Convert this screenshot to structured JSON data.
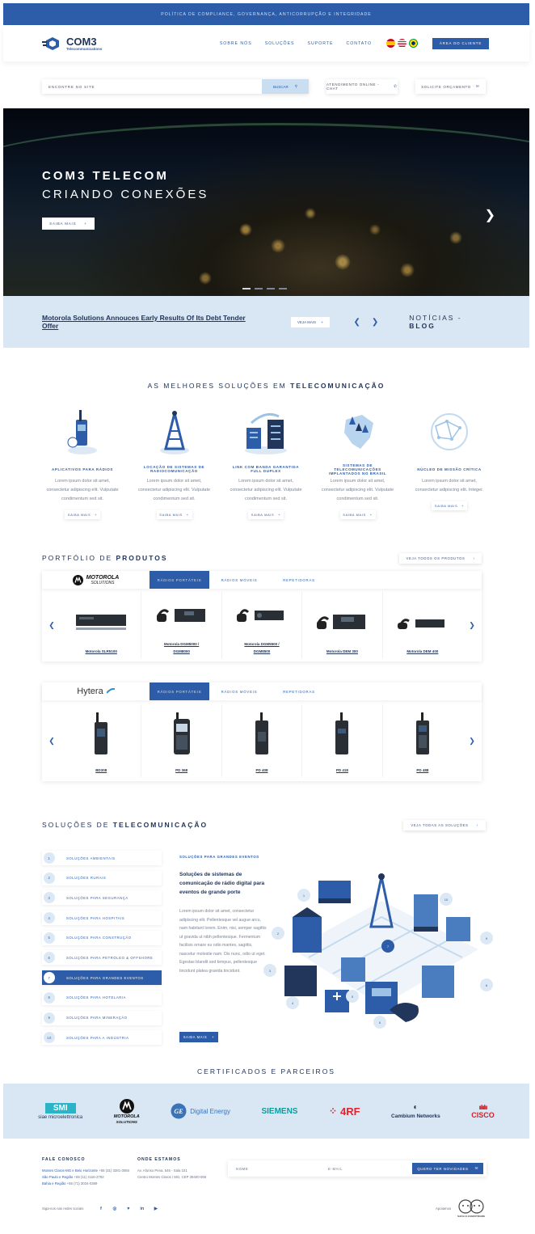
{
  "topbar": {
    "text": "POLÍTICA DE COMPLIANCE, GOVERNANÇA, ANTICORRUPÇÃO E INTEGRIDADE"
  },
  "header": {
    "logo_name": "COM3",
    "logo_sub": "Telecommunications",
    "nav": [
      "SOBRE NÓS",
      "SOLUÇÕES",
      "SUPORTE",
      "CONTATO"
    ],
    "client_button": "ÁREA DO CLIENTE"
  },
  "search": {
    "placeholder": "ENCONTRE NO SITE",
    "button": "BUSCAR",
    "chat": "ATENDIMENTO ONLINE - CHAT",
    "quote": "SOLICITE ORÇAMENTO"
  },
  "hero": {
    "title": "COM3 TELECOM",
    "subtitle": "CRIANDO CONEXÕES",
    "button": "SAIBA MAIS"
  },
  "news": {
    "headline": "Motorola Solutions Annouces Early Results Of Its Debt Tender Offer",
    "button": "VEJA MAIS",
    "section_a": "NOTÍCIAS - ",
    "section_b": "BLOG"
  },
  "solutions": {
    "title_a": "AS MELHORES SOLUÇÕES EM ",
    "title_b": "TELECOMUNICAÇÃO",
    "items": [
      {
        "name": "APLICATIVOS PARA RÁDIOS",
        "desc": "Lorem ipsum dolor sit amet, consectetur adipiscing elit. Vulputate condimentum sed sit.",
        "btn": "SAIBA MAIS"
      },
      {
        "name": "LOCAÇÃO DE SISTEMAS DE RADIOCOMUNICAÇÃO",
        "desc": "Lorem ipsum dolor sit amet, consectetur adipiscing elit. Vulputate condimentum sed sit.",
        "btn": "SAIBA MAIS"
      },
      {
        "name": "LINK COM BANDA GARANTIDA FULL DUPLEX",
        "desc": "Lorem ipsum dolor sit amet, consectetur adipiscing elit. Vulputate condimentum sed sit.",
        "btn": "SAIBA MAIS"
      },
      {
        "name": "SISTEMAS DE TELECOMUNICAÇÕES IMPLANTADOS NO BRASIL",
        "desc": "Lorem ipsum dolor sit amet, consectetur adipiscing elit. Vulputate condimentum sed sit.",
        "btn": "SAIBA MAIS"
      },
      {
        "name": "NÚCLEO DE MISSÃO CRÍTICA",
        "desc": "Lorem ipsum dolor sit amet, consectetur adipiscing elit. Integer.",
        "btn": "SAIBA MAIS"
      }
    ]
  },
  "portfolio": {
    "title_a": "PORTFÓLIO DE ",
    "title_b": "PRODUTOS",
    "all_button": "VEJA TODOS OS PRODUTOS",
    "tabs": [
      "RÁDIOS PORTÁTEIS",
      "RÁDIOS MÓVEIS",
      "REPETIDORAS"
    ],
    "motorola": {
      "brand": "MOTOROLA",
      "brand_sub": "SOLUTIONS",
      "products": [
        "Motorola SLR5100",
        "Motorola DGM5000 / DGM8000",
        "Motorola DGM5500 / DGM8500",
        "Motorola DEM 300",
        "Motorola DEM 400"
      ]
    },
    "hytera": {
      "brand": "Hytera",
      "products": [
        "BD308",
        "PD 368",
        "PD 408",
        "PD 418",
        "PD 488"
      ]
    }
  },
  "telecom": {
    "title_a": "SOLUÇÕES DE ",
    "title_b": "TELECOMUNICAÇÃO",
    "all_button": "VEJA TODAS AS SOLUÇÕES",
    "items": [
      {
        "n": "1",
        "label": "SOLUÇÕES AMBIENTAIS"
      },
      {
        "n": "2",
        "label": "SOLUÇÕES RURAIS"
      },
      {
        "n": "3",
        "label": "SOLUÇÕES PARA SEGURANÇA"
      },
      {
        "n": "4",
        "label": "SOLUÇÕES PARA HOSPITAIS"
      },
      {
        "n": "5",
        "label": "SOLUÇÕES PARA CONSTRUÇÃO"
      },
      {
        "n": "6",
        "label": "SOLUÇÕES PARA PETRÓLEO & OFFSHORE"
      },
      {
        "n": "7",
        "label": "SOLUÇÕES PARA GRANDES EVENTOS"
      },
      {
        "n": "8",
        "label": "SOLUÇÕES PARA HOTELARIA"
      },
      {
        "n": "9",
        "label": "SOLUÇÕES PARA MINERAÇÃO"
      },
      {
        "n": "10",
        "label": "SOLUÇÕES PARA A INDÚSTRIA"
      }
    ],
    "active_index": 6,
    "kicker": "SOLUÇÕES PARA GRANDES EVENTOS",
    "heading": "Soluções de sistemas de comunicação de rádio digital para eventos de grande porte",
    "body": "Lorem ipsum dolor sit amet, consectetur adipiscing elit. Pellentesque vel augue arcu, nam habitant lorem. Enim, nisi, semper sagittis ut gravida ut nibh pellentesque. Fermentum facilisis ornare eu odio mantes, sagittis, nascetur molestie nam. Dis nunc, odio ut eget. Egestas blandit sed tempus, pellentesque tincidunt platea gravida tincidunt.",
    "button": "SAIBA MAIS",
    "bubbles": [
      "1",
      "2",
      "3",
      "4",
      "5",
      "6",
      "7",
      "8",
      "9",
      "10"
    ]
  },
  "partners": {
    "title": "CERTIFICADOS E PARCEIROS",
    "items": [
      "SMI",
      "siae microelettronica",
      "MOTOROLA",
      "SOLUTIONS",
      "Digital Energy",
      "SIEMENS",
      "4RF",
      "Cambium Networks",
      "CISCO"
    ]
  },
  "footer": {
    "contact_title": "FALE CONOSCO",
    "contact_lines": [
      {
        "hl": "Montes Claros-MG e Belo Horizonte",
        "rest": " +55 (31) 3281-3084"
      },
      {
        "hl": "São Paulo e Região",
        "rest": " +55 (11) 4116-2792"
      },
      {
        "hl": "Bahia e Região",
        "rest": " +55 (71) 3034-0369"
      }
    ],
    "where_title": "ONDE ESTAMOS",
    "where_lines": [
      "Av. Afonso Pena, 546 - Sala 101",
      "Centro Montes Claros / MG, CEP 39400-066"
    ],
    "name_field": "NOME",
    "email_field": "E-MAIL",
    "news_button": "QUERO TER NOVIDADES",
    "social_label": "Siga-nos nas redes sociais",
    "support_label": "Apoiamos",
    "support_logo": "SAFIA E ZANZOTIDADE"
  },
  "colors": {
    "primary": "#2d5ca8",
    "light_blue": "#d8e7f3",
    "dark_text": "#22355a"
  }
}
